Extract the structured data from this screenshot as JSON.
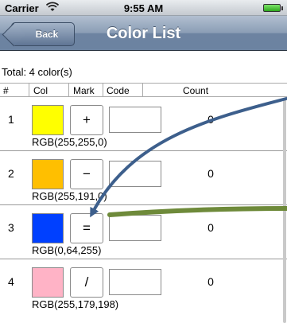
{
  "status_bar": {
    "carrier": "Carrier",
    "time": "9:55 AM"
  },
  "nav_bar": {
    "title": "Color List",
    "back_label": "Back"
  },
  "total_label": "Total: 4 color(s)",
  "columns": {
    "number": "#",
    "color": "Col",
    "mark": "Mark",
    "code": "Code",
    "count": "Count"
  },
  "rows": [
    {
      "number": "1",
      "color_hex": "#ffff00",
      "mark": "+",
      "code": "",
      "count": "0",
      "rgb": "RGB(255,255,0)"
    },
    {
      "number": "2",
      "color_hex": "#ffbf00",
      "mark": "−",
      "code": "",
      "count": "0",
      "rgb": "RGB(255,191,0)"
    },
    {
      "number": "3",
      "color_hex": "#0040ff",
      "mark": "=",
      "code": "",
      "count": "0",
      "rgb": "RGB(0,64,255)"
    },
    {
      "number": "4",
      "color_hex": "#ffb3c6",
      "mark": "/",
      "code": "",
      "count": "0",
      "rgb": "RGB(255,179,198)"
    }
  ],
  "annotations": {
    "blue_arrow_color": "#3d5f8c",
    "green_arrow_color": "#6e8a3a"
  },
  "icons": {
    "wifi": "wifi-icon",
    "battery": "battery-icon",
    "back": "back-chevron"
  }
}
